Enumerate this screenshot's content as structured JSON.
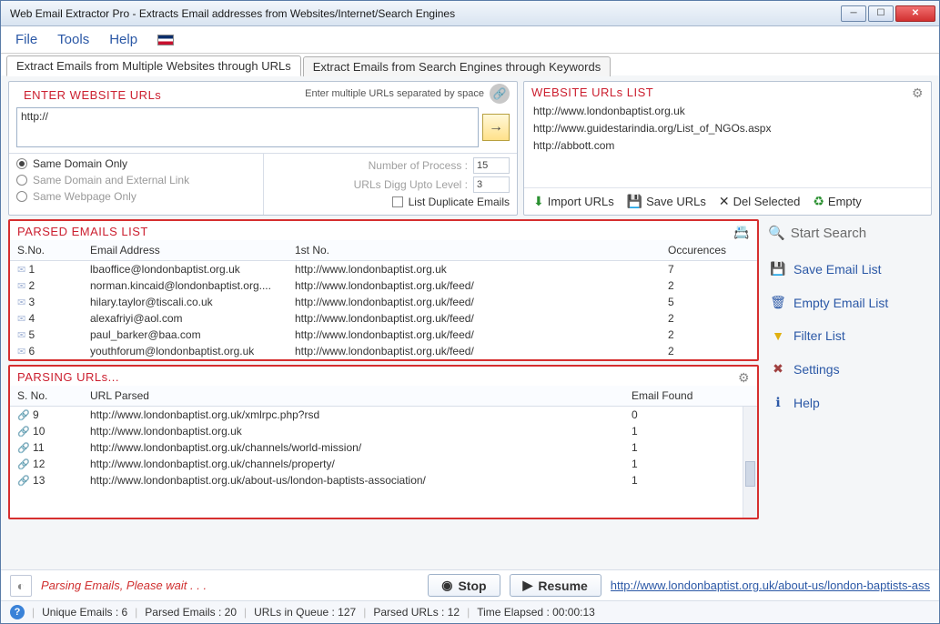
{
  "window": {
    "title": "Web Email Extractor Pro - Extracts Email addresses from Websites/Internet/Search Engines"
  },
  "menu": {
    "file": "File",
    "tools": "Tools",
    "help": "Help"
  },
  "tabs": {
    "urls": "Extract Emails from Multiple Websites through URLs",
    "keywords": "Extract Emails from Search Engines through Keywords"
  },
  "enter": {
    "title": "ENTER WEBSITE URLs",
    "hint": "Enter multiple URLs separated by space",
    "value": "http://",
    "opts": {
      "same_domain": "Same Domain Only",
      "same_ext": "Same Domain and External Link",
      "same_page": "Same Webpage Only",
      "num_proc_label": "Number of Process :",
      "num_proc": "15",
      "digg_label": "URLs Digg Upto Level :",
      "digg": "3",
      "dup_label": "List Duplicate Emails"
    }
  },
  "urlslist": {
    "title": "WEBSITE URLs LIST",
    "items": [
      "http://www.londonbaptist.org.uk",
      "http://www.guidestarindia.org/List_of_NGOs.aspx",
      "http://abbott.com"
    ],
    "tools": {
      "import": "Import URLs",
      "save": "Save URLs",
      "del": "Del Selected",
      "empty": "Empty"
    }
  },
  "parsed_emails": {
    "title": "PARSED EMAILS LIST",
    "cols": {
      "sn": "S.No.",
      "email": "Email Address",
      "url": "1st No.",
      "occ": "Occurences"
    },
    "rows": [
      {
        "sn": "1",
        "email": "lbaoffice@londonbaptist.org.uk",
        "url": "http://www.londonbaptist.org.uk",
        "occ": "7"
      },
      {
        "sn": "2",
        "email": "norman.kincaid@londonbaptist.org....",
        "url": "http://www.londonbaptist.org.uk/feed/",
        "occ": "2"
      },
      {
        "sn": "3",
        "email": "hilary.taylor@tiscali.co.uk",
        "url": "http://www.londonbaptist.org.uk/feed/",
        "occ": "5"
      },
      {
        "sn": "4",
        "email": "alexafriyi@aol.com",
        "url": "http://www.londonbaptist.org.uk/feed/",
        "occ": "2"
      },
      {
        "sn": "5",
        "email": "paul_barker@baa.com",
        "url": "http://www.londonbaptist.org.uk/feed/",
        "occ": "2"
      },
      {
        "sn": "6",
        "email": "youthforum@londonbaptist.org.uk",
        "url": "http://www.londonbaptist.org.uk/feed/",
        "occ": "2"
      }
    ]
  },
  "parsing_urls": {
    "title": "PARSING URLs...",
    "cols": {
      "sn": "S. No.",
      "url": "URL Parsed",
      "ef": "Email Found"
    },
    "rows": [
      {
        "sn": "9",
        "url": "http://www.londonbaptist.org.uk/xmlrpc.php?rsd",
        "ef": "0"
      },
      {
        "sn": "10",
        "url": "http://www.londonbaptist.org.uk",
        "ef": "1"
      },
      {
        "sn": "11",
        "url": "http://www.londonbaptist.org.uk/channels/world-mission/",
        "ef": "1"
      },
      {
        "sn": "12",
        "url": "http://www.londonbaptist.org.uk/channels/property/",
        "ef": "1"
      },
      {
        "sn": "13",
        "url": "http://www.londonbaptist.org.uk/about-us/london-baptists-association/",
        "ef": "1"
      }
    ]
  },
  "side": {
    "start": "Start Search",
    "save": "Save Email List",
    "empty": "Empty Email List",
    "filter": "Filter List",
    "settings": "Settings",
    "help": "Help"
  },
  "bottom": {
    "msg": "Parsing Emails, Please wait . . .",
    "stop": "Stop",
    "resume": "Resume",
    "url": "http://www.londonbaptist.org.uk/about-us/london-baptists-ass"
  },
  "status": {
    "unique": "Unique Emails :  6",
    "parsed_e": "Parsed Emails :  20",
    "queue": "URLs in Queue :  127",
    "parsed_u": "Parsed URLs :  12",
    "time": "Time Elapsed :   00:00:13"
  }
}
